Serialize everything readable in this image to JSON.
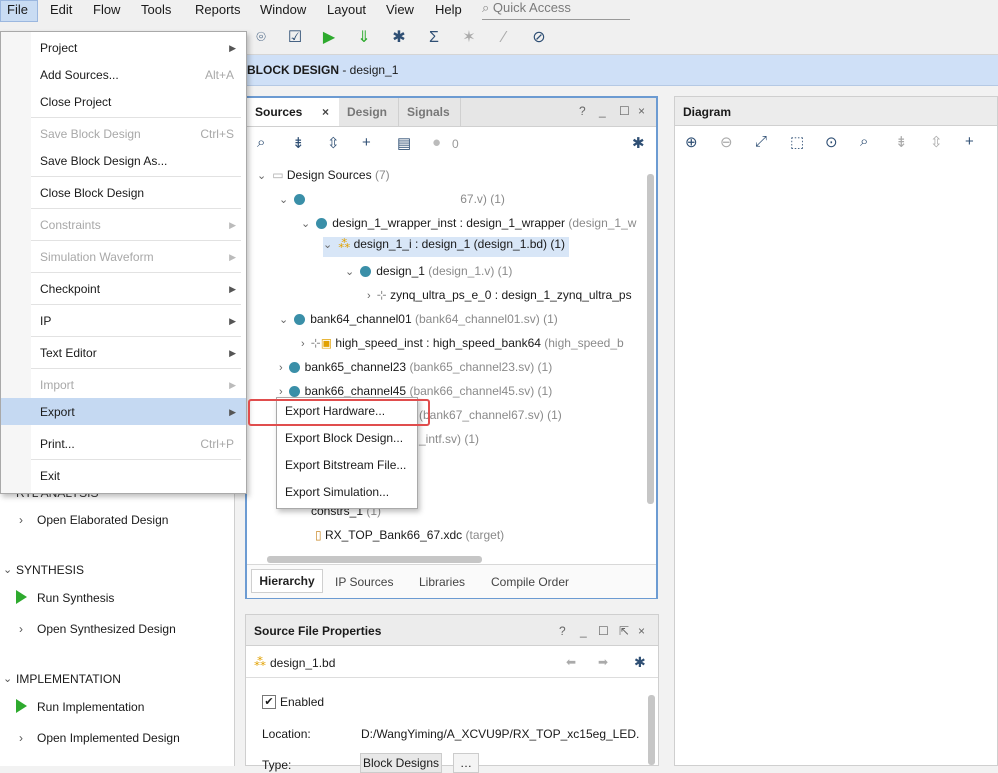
{
  "menubar": {
    "items": [
      "File",
      "Edit",
      "Flow",
      "Tools",
      "Reports",
      "Window",
      "Layout",
      "View",
      "Help"
    ],
    "quick_access_placeholder": "Quick Access"
  },
  "toolbar": {
    "icons": [
      "binoculars-icon",
      "checkbox-icon",
      "run-icon",
      "download-icon",
      "gear-icon",
      "sigma-icon",
      "debug-icon",
      "probe-icon",
      "disabled-icon"
    ]
  },
  "banner": {
    "title_bold": "BLOCK DESIGN",
    "title_rest": " - design_1"
  },
  "flow_nav": {
    "rtl_analysis": "RTL ANALYSIS",
    "open_elaborated": "Open Elaborated Design",
    "synthesis": "SYNTHESIS",
    "run_synthesis": "Run Synthesis",
    "open_synthesized": "Open Synthesized Design",
    "implementation": "IMPLEMENTATION",
    "run_implementation": "Run Implementation",
    "open_implemented": "Open Implemented Design"
  },
  "sources": {
    "tabs": [
      "Sources",
      "Design",
      "Signals"
    ],
    "badge_count": "0",
    "tree": {
      "design_sources": "Design Sources",
      "design_sources_count": "(7)",
      "top_file": "67.v) (1)",
      "wrapper_name": "design_1_wrapper_inst : design_1_wrapper",
      "wrapper_file": "(design_1_w",
      "design_i": "design_1_i : design_1 (design_1.bd) (1)",
      "design_1": "design_1",
      "design_1_file": "(design_1.v) (1)",
      "zynq": "zynq_ultra_ps_e_0 : design_1_zynq_ultra_ps",
      "bank64": "bank64_channel01",
      "bank64_file": "(bank64_channel01.sv) (1)",
      "high_speed": "high_speed_inst : high_speed_bank64",
      "high_speed_file": "(high_speed_b",
      "bank65": "bank65_channel23",
      "bank65_file": "(bank65_channel23.sv) (1)",
      "bank66": "bank66_channel45",
      "bank66_file": "(bank66_channel45.sv) (1)",
      "bank67_file": "(bank67_channel67.sv) (1)",
      "intf_file": "_intf.sv) (1)",
      "constrs": "constrs_1",
      "constrs_count": "(1)",
      "xdc": "RX_TOP_Bank66_67.xdc",
      "xdc_target": "(target)"
    },
    "bottom_tabs": [
      "Hierarchy",
      "IP Sources",
      "Libraries",
      "Compile Order"
    ]
  },
  "props": {
    "title": "Source File Properties",
    "file": "design_1.bd",
    "enabled_label": "Enabled",
    "location_label": "Location:",
    "location_value": "D:/WangYiming/A_XCVU9P/RX_TOP_xc15eg_LED.",
    "type_label": "Type:",
    "type_value": "Block Designs"
  },
  "diagram": {
    "title": "Diagram"
  },
  "file_menu": {
    "project": "Project",
    "add_sources": "Add Sources...",
    "add_sources_sc": "Alt+A",
    "close_project": "Close Project",
    "save_block": "Save Block Design",
    "save_block_sc": "Ctrl+S",
    "save_block_as": "Save Block Design As...",
    "close_block": "Close Block Design",
    "constraints": "Constraints",
    "sim_waveform": "Simulation Waveform",
    "checkpoint": "Checkpoint",
    "ip": "IP",
    "text_editor": "Text Editor",
    "import": "Import",
    "export": "Export",
    "print": "Print...",
    "print_sc": "Ctrl+P",
    "exit": "Exit"
  },
  "export_menu": {
    "hardware": "Export Hardware...",
    "block_design": "Export Block Design...",
    "bitstream": "Export Bitstream File...",
    "simulation": "Export Simulation..."
  }
}
